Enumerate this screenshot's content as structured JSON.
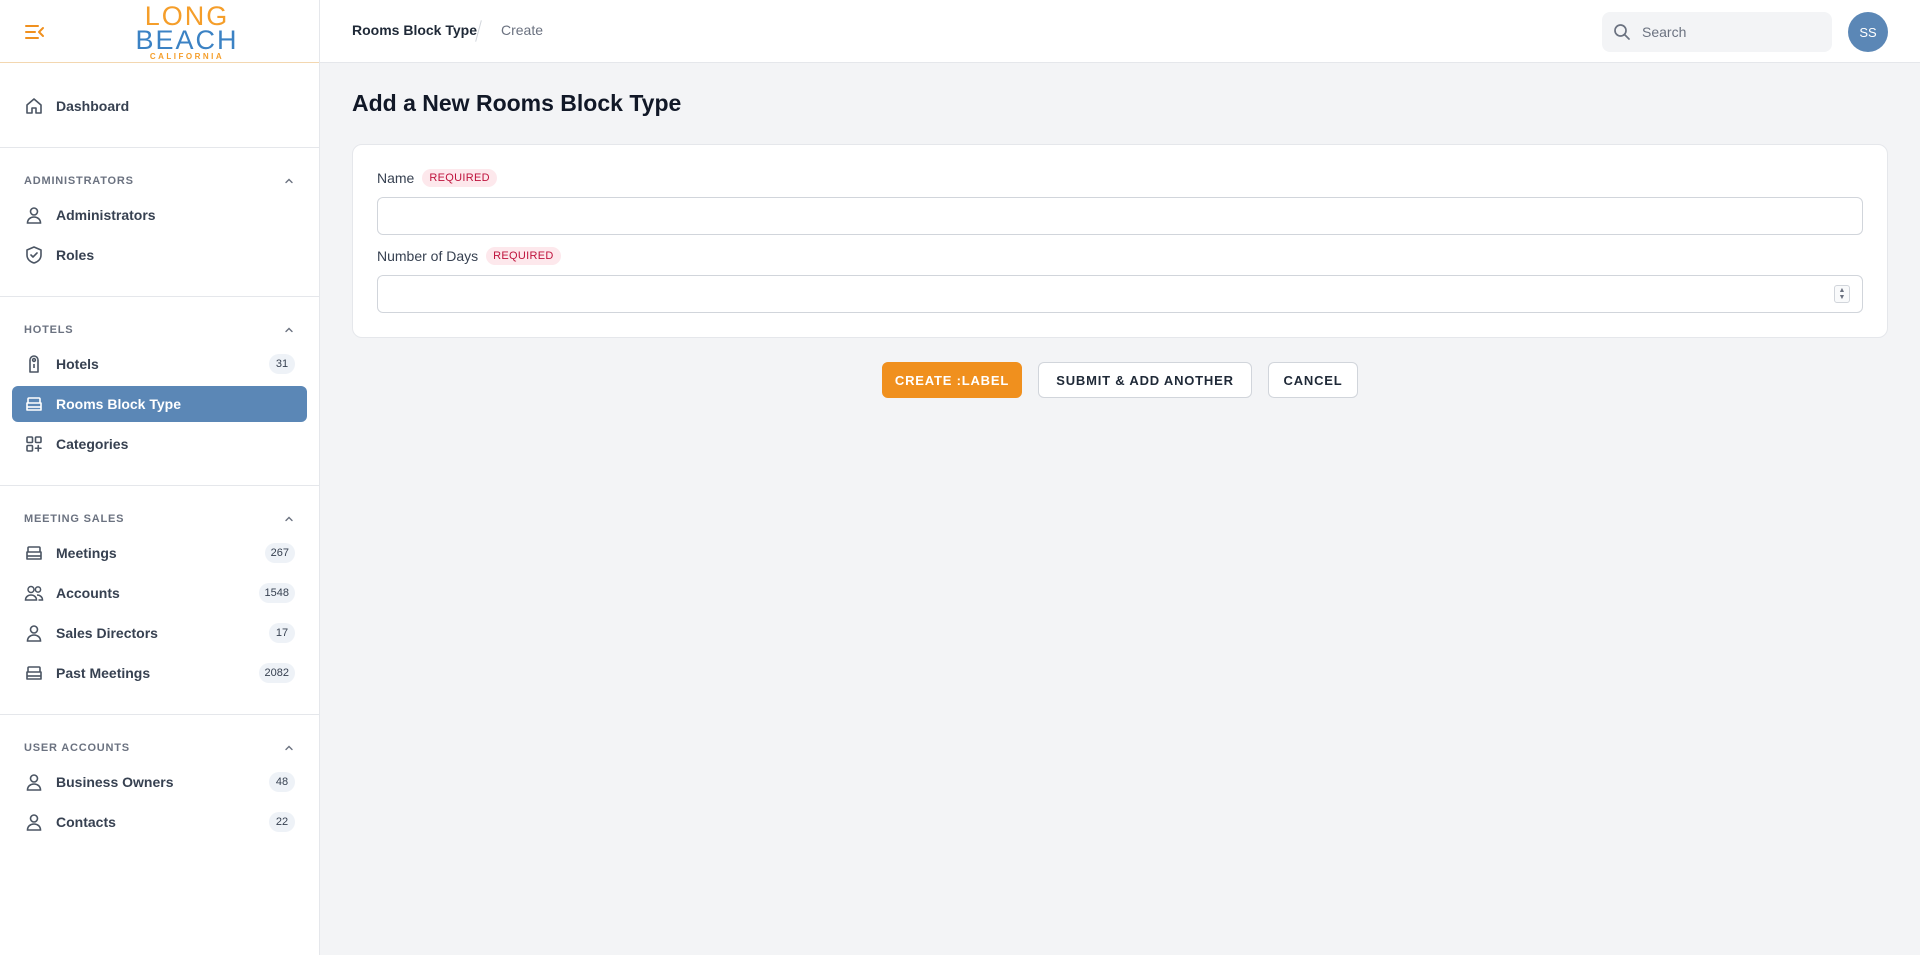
{
  "brand": {
    "line1": "LONG",
    "line2": "BEACH",
    "line3": "CALIFORNIA"
  },
  "sidebar": {
    "dashboard": {
      "label": "Dashboard"
    },
    "sections": [
      {
        "title": "ADMINISTRATORS",
        "items": [
          {
            "label": "Administrators"
          },
          {
            "label": "Roles"
          }
        ]
      },
      {
        "title": "HOTELS",
        "items": [
          {
            "label": "Hotels",
            "badge": "31"
          },
          {
            "label": "Rooms Block Type",
            "active": true
          },
          {
            "label": "Categories"
          }
        ]
      },
      {
        "title": "MEETING SALES",
        "items": [
          {
            "label": "Meetings",
            "badge": "267"
          },
          {
            "label": "Accounts",
            "badge": "1548"
          },
          {
            "label": "Sales Directors",
            "badge": "17"
          },
          {
            "label": "Past Meetings",
            "badge": "2082"
          }
        ]
      },
      {
        "title": "USER ACCOUNTS",
        "items": [
          {
            "label": "Business Owners",
            "badge": "48"
          },
          {
            "label": "Contacts",
            "badge": "22"
          }
        ]
      }
    ]
  },
  "topbar": {
    "breadcrumb": [
      "Rooms Block Type",
      "Create"
    ],
    "search": {
      "placeholder": "Search",
      "value": ""
    },
    "avatar_initials": "SS"
  },
  "main": {
    "title": "Add a New Rooms Block Type",
    "fields": [
      {
        "label": "Name",
        "badge": "REQUIRED",
        "value": ""
      },
      {
        "label": "Number of Days",
        "badge": "REQUIRED",
        "value": ""
      }
    ],
    "buttons": {
      "create": "CREATE :LABEL",
      "submit_add": "SUBMIT & ADD ANOTHER",
      "cancel": "CANCEL"
    }
  },
  "colors": {
    "accent": "#f0901e",
    "active_nav": "#5b87b6",
    "required_text": "#be123c",
    "required_bg": "#fde8ec"
  }
}
